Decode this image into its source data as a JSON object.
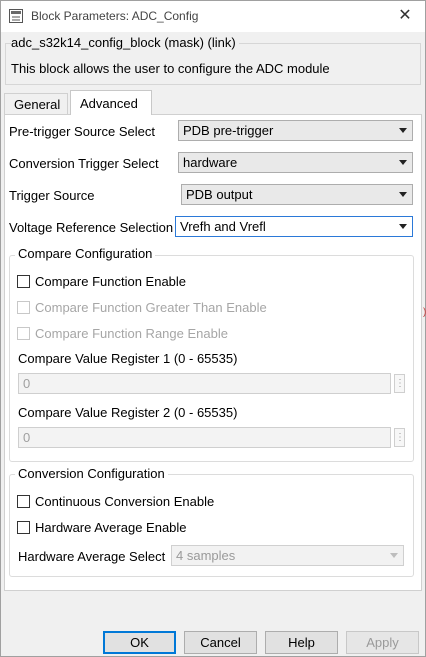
{
  "window": {
    "title": "Block Parameters: ADC_Config"
  },
  "mask": {
    "title": "adc_s32k14_config_block (mask) (link)",
    "description": "This block allows the user to configure the ADC module"
  },
  "tabs": [
    {
      "label": "General",
      "selected": false
    },
    {
      "label": "Advanced",
      "selected": true
    }
  ],
  "params": {
    "pretrigger": {
      "label": "Pre-trigger Source Select",
      "value": "PDB pre-trigger"
    },
    "conversion_trigger": {
      "label": "Conversion Trigger Select",
      "value": "hardware"
    },
    "trigger_source": {
      "label": "Trigger Source",
      "value": "PDB output"
    },
    "voltage_ref": {
      "label": "Voltage Reference Selection",
      "value": "Vrefh and Vrefl"
    }
  },
  "compare": {
    "title": "Compare Configuration",
    "function_enable": {
      "label": "Compare Function Enable",
      "checked": false
    },
    "greater_than": {
      "label": "Compare Function Greater Than Enable",
      "checked": false
    },
    "range_enable": {
      "label": "Compare Function Range Enable",
      "checked": false
    },
    "register1": {
      "label": "Compare Value Register 1 (0 - 65535)",
      "value": "0"
    },
    "register2": {
      "label": "Compare Value Register 2 (0 - 65535)",
      "value": "0"
    },
    "spin_glyph": "⋮"
  },
  "conversion": {
    "title": "Conversion Configuration",
    "continuous": {
      "label": "Continuous Conversion Enable",
      "checked": false
    },
    "hw_average": {
      "label": "Hardware Average Enable",
      "checked": false
    },
    "hw_average_select": {
      "label": "Hardware Average Select",
      "value": "4 samples"
    }
  },
  "buttons": {
    "ok": "OK",
    "cancel": "Cancel",
    "help": "Help",
    "apply": "Apply"
  },
  "colors": {
    "focus_border": "#2b79d8",
    "default_button_border": "#0078d7"
  },
  "edge_mark": ")"
}
